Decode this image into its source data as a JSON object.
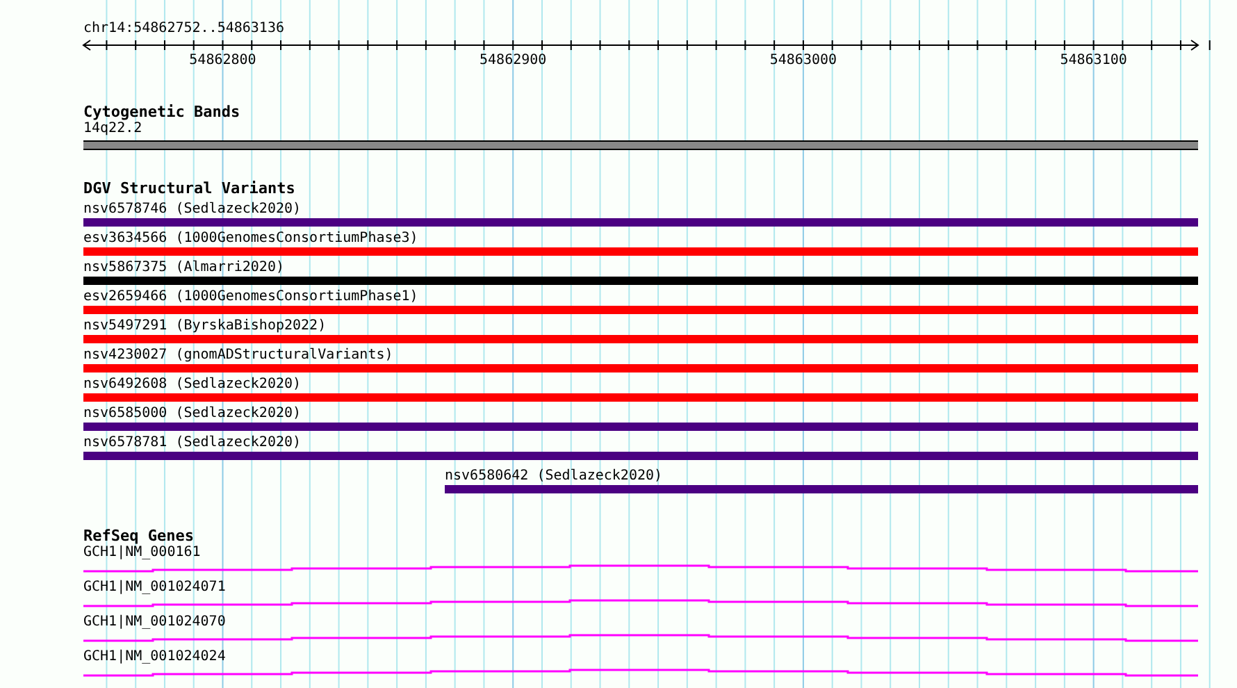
{
  "ruler": {
    "region": "chr14:54862752..54863136",
    "tick_labels": [
      "54862800",
      "54862900",
      "54863000",
      "54863100"
    ]
  },
  "cytogenetic_bands": {
    "title": "Cytogenetic Bands",
    "band": "14q22.2"
  },
  "dgv_structural_variants": {
    "title": "DGV Structural Variants",
    "items": [
      {
        "label": "nsv6578746 (Sedlazeck2020)",
        "color": "#4b0082"
      },
      {
        "label": "esv3634566 (1000GenomesConsortiumPhase3)",
        "color": "#ff0000"
      },
      {
        "label": "nsv5867375 (Almarri2020)",
        "color": "#000000"
      },
      {
        "label": "esv2659466 (1000GenomesConsortiumPhase1)",
        "color": "#ff0000"
      },
      {
        "label": "nsv5497291 (ByrskaBishop2022)",
        "color": "#ff0000"
      },
      {
        "label": "nsv4230027 (gnomADStructuralVariants)",
        "color": "#ff0000"
      },
      {
        "label": "nsv6492608 (Sedlazeck2020)",
        "color": "#ff0000"
      },
      {
        "label": "nsv6585000 (Sedlazeck2020)",
        "color": "#4b0082"
      },
      {
        "label": "nsv6578781 (Sedlazeck2020)",
        "color": "#4b0082"
      },
      {
        "label": "nsv6580642 (Sedlazeck2020)",
        "color": "#4b0082",
        "kind": "partial"
      }
    ]
  },
  "refseq_genes": {
    "title": "RefSeq Genes",
    "items": [
      {
        "label": "GCH1|NM_000161"
      },
      {
        "label": "GCH1|NM_001024071"
      },
      {
        "label": "GCH1|NM_001024070"
      },
      {
        "label": "GCH1|NM_001024024"
      }
    ]
  }
}
